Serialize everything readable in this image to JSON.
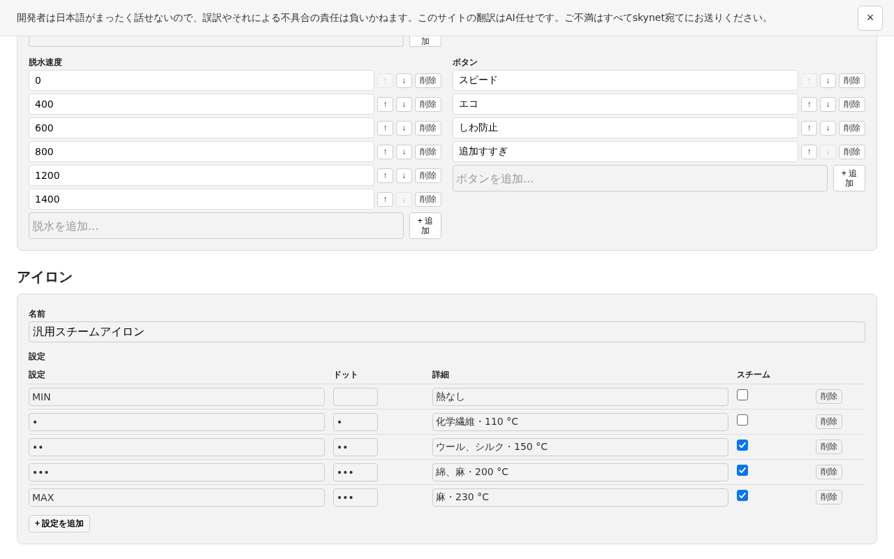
{
  "banner": {
    "text": "開発者は日本語がまったく話せないので、誤訳やそれによる不具合の責任は負いかねます。このサイトの翻訳はAI任せです。ご不満はすべてskynet宛てにお送りください。",
    "close": "×"
  },
  "washer": {
    "partial_add_button": "加",
    "lists": [
      {
        "label": "脱水速度",
        "items": [
          {
            "value": "0",
            "up": "↑",
            "down": "↓",
            "delete": "削除",
            "up_disabled": true,
            "down_disabled": false
          },
          {
            "value": "400",
            "up": "↑",
            "down": "↓",
            "delete": "削除",
            "up_disabled": false,
            "down_disabled": false
          },
          {
            "value": "600",
            "up": "↑",
            "down": "↓",
            "delete": "削除",
            "up_disabled": false,
            "down_disabled": false
          },
          {
            "value": "800",
            "up": "↑",
            "down": "↓",
            "delete": "削除",
            "up_disabled": false,
            "down_disabled": false
          },
          {
            "value": "1200",
            "up": "↑",
            "down": "↓",
            "delete": "削除",
            "up_disabled": false,
            "down_disabled": false
          },
          {
            "value": "1400",
            "up": "↑",
            "down": "↓",
            "delete": "削除",
            "up_disabled": false,
            "down_disabled": true
          }
        ],
        "add_placeholder": "脱水を追加...",
        "add_button": "+ 追加"
      },
      {
        "label": "ボタン",
        "items": [
          {
            "value": "スピード",
            "up": "↑",
            "down": "↓",
            "delete": "削除",
            "up_disabled": true,
            "down_disabled": false
          },
          {
            "value": "エコ",
            "up": "↑",
            "down": "↓",
            "delete": "削除",
            "up_disabled": false,
            "down_disabled": false
          },
          {
            "value": "しわ防止",
            "up": "↑",
            "down": "↓",
            "delete": "削除",
            "up_disabled": false,
            "down_disabled": false
          },
          {
            "value": "追加すすぎ",
            "up": "↑",
            "down": "↓",
            "delete": "削除",
            "up_disabled": false,
            "down_disabled": true
          }
        ],
        "add_placeholder": "ボタンを追加...",
        "add_button": "+ 追加"
      }
    ]
  },
  "iron": {
    "title": "アイロン",
    "name_label": "名前",
    "name_value": "汎用スチームアイロン",
    "settings_label": "設定",
    "columns": [
      "設定",
      "ドット",
      "詳細",
      "スチーム"
    ],
    "rows": [
      {
        "setting": "MIN",
        "dots": "",
        "detail": "熱なし",
        "steam": false,
        "delete": "削除"
      },
      {
        "setting": "•",
        "dots": "•",
        "detail": "化学繊維・110 °C",
        "steam": false,
        "delete": "削除"
      },
      {
        "setting": "••",
        "dots": "••",
        "detail": "ウール、シルク・150 °C",
        "steam": true,
        "delete": "削除"
      },
      {
        "setting": "•••",
        "dots": "•••",
        "detail": "綿、麻・200 °C",
        "steam": true,
        "delete": "削除"
      },
      {
        "setting": "MAX",
        "dots": "•••",
        "detail": "麻・230 °C",
        "steam": true,
        "delete": "削除"
      }
    ],
    "add_button": "+ 設定を追加"
  }
}
